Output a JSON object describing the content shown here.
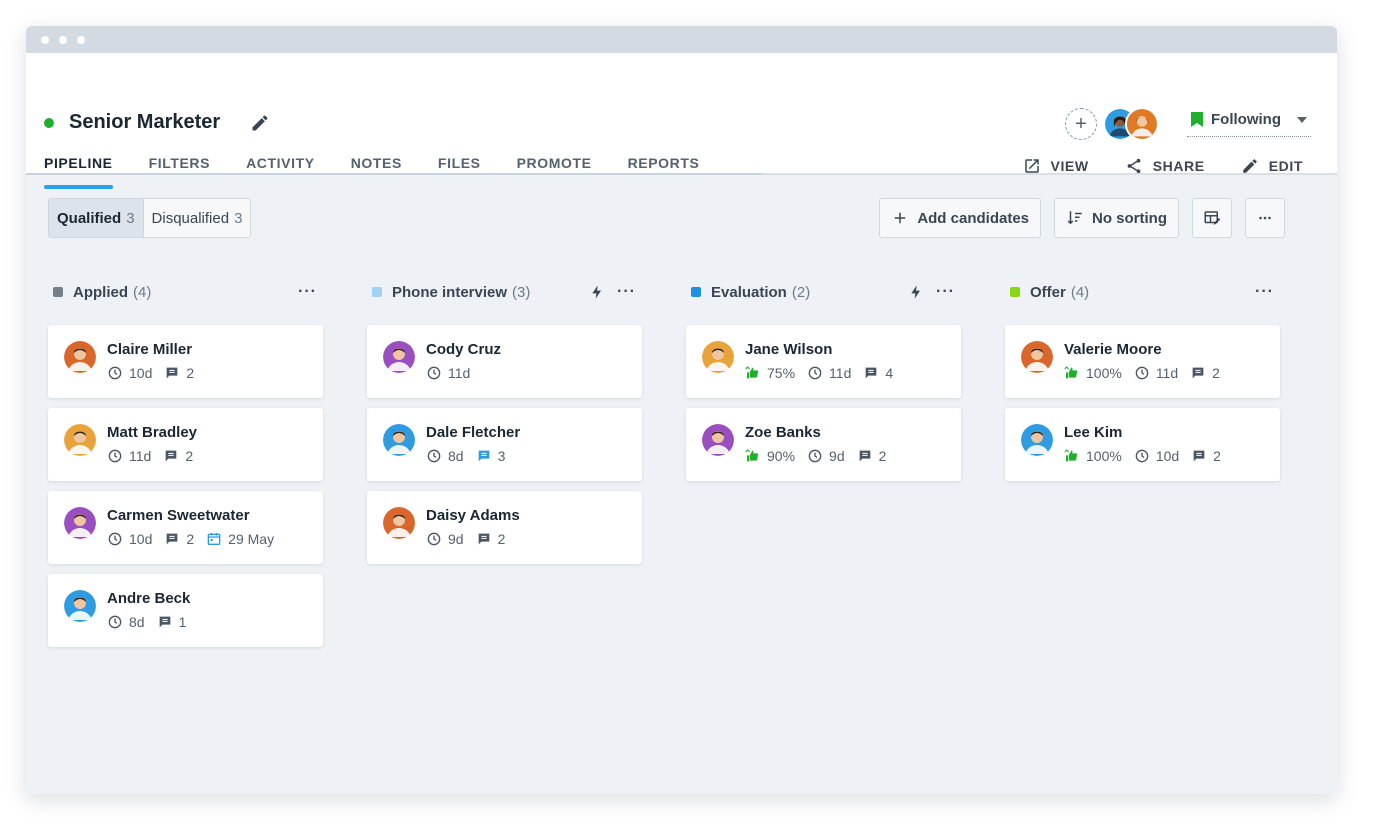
{
  "window": {
    "dots": 3
  },
  "job": {
    "title": "Senior Marketer",
    "status_color": "#20b02e"
  },
  "tabs": [
    {
      "label": "PIPELINE",
      "active": true
    },
    {
      "label": "FILTERS"
    },
    {
      "label": "ACTIVITY"
    },
    {
      "label": "NOTES"
    },
    {
      "label": "FILES"
    },
    {
      "label": "PROMOTE"
    },
    {
      "label": "REPORTS"
    }
  ],
  "follow": {
    "label": "Following",
    "flag_color": "#20b02e"
  },
  "actions": {
    "view": "VIEW",
    "share": "SHARE",
    "edit": "EDIT"
  },
  "filter": {
    "qualified_label": "Qualified",
    "qualified_count": "3",
    "disqualified_label": "Disqualified",
    "disqualified_count": "3"
  },
  "toolbar": {
    "add_candidates": "Add candidates",
    "sorting": "No sorting"
  },
  "accent": "#2aa0e6",
  "columns": [
    {
      "name": "Applied",
      "count": "(4)",
      "color": "#747f8c",
      "automation": false,
      "cards": [
        {
          "name": "Claire Miller",
          "avatar_color": "#d9662b",
          "meta": [
            {
              "icon": "clock-icon",
              "text": "10d"
            },
            {
              "icon": "comment-icon",
              "text": "2"
            }
          ]
        },
        {
          "name": "Matt Bradley",
          "avatar_color": "#e8a33a",
          "meta": [
            {
              "icon": "clock-icon",
              "text": "11d"
            },
            {
              "icon": "comment-icon",
              "text": "2"
            }
          ]
        },
        {
          "name": "Carmen Sweetwater",
          "avatar_color": "#9a4fc0",
          "meta": [
            {
              "icon": "clock-icon",
              "text": "10d"
            },
            {
              "icon": "comment-icon",
              "text": "2"
            },
            {
              "icon": "calendar-icon",
              "text": "29 May"
            }
          ]
        },
        {
          "name": "Andre Beck",
          "avatar_color": "#2f9be0",
          "meta": [
            {
              "icon": "clock-icon",
              "text": "8d"
            },
            {
              "icon": "comment-icon",
              "text": "1"
            }
          ]
        }
      ]
    },
    {
      "name": "Phone interview",
      "count": "(3)",
      "color": "#9fd3f3",
      "automation": true,
      "cards": [
        {
          "name": "Cody Cruz",
          "avatar_color": "#9a4fc0",
          "meta": [
            {
              "icon": "clock-icon",
              "text": "11d"
            }
          ]
        },
        {
          "name": "Dale Fletcher",
          "avatar_color": "#2f9be0",
          "meta": [
            {
              "icon": "clock-icon",
              "text": "8d"
            },
            {
              "icon": "comment-blue-icon",
              "text": "3"
            }
          ]
        },
        {
          "name": "Daisy Adams",
          "avatar_color": "#d9662b",
          "meta": [
            {
              "icon": "clock-icon",
              "text": "9d"
            },
            {
              "icon": "comment-icon",
              "text": "2"
            }
          ]
        }
      ]
    },
    {
      "name": "Evaluation",
      "count": "(2)",
      "color": "#1f8fe0",
      "automation": true,
      "cards": [
        {
          "name": "Jane Wilson",
          "avatar_color": "#e8a33a",
          "meta": [
            {
              "icon": "thumbs-icon",
              "text": "75%"
            },
            {
              "icon": "clock-icon",
              "text": "11d"
            },
            {
              "icon": "comment-icon",
              "text": "4"
            }
          ]
        },
        {
          "name": "Zoe Banks",
          "avatar_color": "#9a4fc0",
          "meta": [
            {
              "icon": "thumbs-icon",
              "text": "90%"
            },
            {
              "icon": "clock-icon",
              "text": "9d"
            },
            {
              "icon": "comment-icon",
              "text": "2"
            }
          ]
        }
      ]
    },
    {
      "name": "Offer",
      "count": "(4)",
      "color": "#8ad613",
      "automation": false,
      "cards": [
        {
          "name": "Valerie Moore",
          "avatar_color": "#d9662b",
          "meta": [
            {
              "icon": "thumbs-icon",
              "text": "100%"
            },
            {
              "icon": "clock-icon",
              "text": "11d"
            },
            {
              "icon": "comment-icon",
              "text": "2"
            }
          ]
        },
        {
          "name": "Lee Kim",
          "avatar_color": "#2f9be0",
          "meta": [
            {
              "icon": "thumbs-icon",
              "text": "100%"
            },
            {
              "icon": "clock-icon",
              "text": "10d"
            },
            {
              "icon": "comment-icon",
              "text": "2"
            }
          ]
        }
      ]
    }
  ]
}
